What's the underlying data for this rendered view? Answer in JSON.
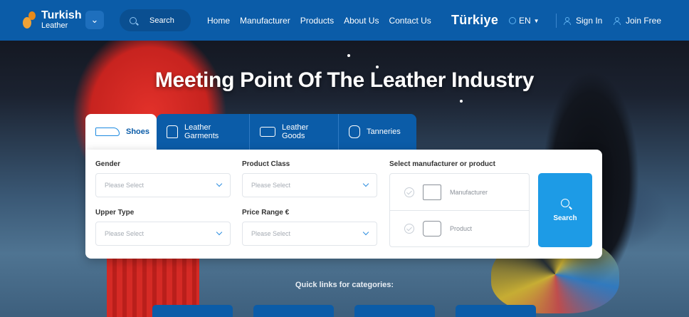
{
  "nav": {
    "logo_title": "Turkish",
    "logo_subtitle": "Leather",
    "search_label": "Search",
    "links": [
      "Home",
      "Manufacturer",
      "Products",
      "About Us",
      "Contact Us"
    ],
    "country": "Türkiye",
    "language": "EN",
    "sign_in": "Sign In",
    "join_free": "Join Free"
  },
  "hero": {
    "headline": "Meeting Point Of The Leather Industry"
  },
  "tabs": [
    {
      "label": "Shoes",
      "icon": "shoe-icon",
      "active": true
    },
    {
      "label": "Leather Garments",
      "icon": "jacket-icon",
      "active": false
    },
    {
      "label": "Leather Goods",
      "icon": "bag-icon",
      "active": false
    },
    {
      "label": "Tanneries",
      "icon": "hide-icon",
      "active": false
    }
  ],
  "form": {
    "gender_label": "Gender",
    "gender_value": "Please Select",
    "product_class_label": "Product Class",
    "product_class_value": "Please Select",
    "upper_type_label": "Upper Type",
    "upper_type_value": "Please Select",
    "price_range_label": "Price Range €",
    "price_range_value": "Please Select",
    "select_label": "Select manufacturer or product",
    "manufacturer_option": "Manufacturer",
    "product_option": "Product",
    "search_button": "Search"
  },
  "quick_links": {
    "title": "Quick links for categories:"
  },
  "colors": {
    "nav_blue": "#0b5ca8",
    "accent_blue": "#1d9be6",
    "logo_orange": "#f0a236"
  }
}
